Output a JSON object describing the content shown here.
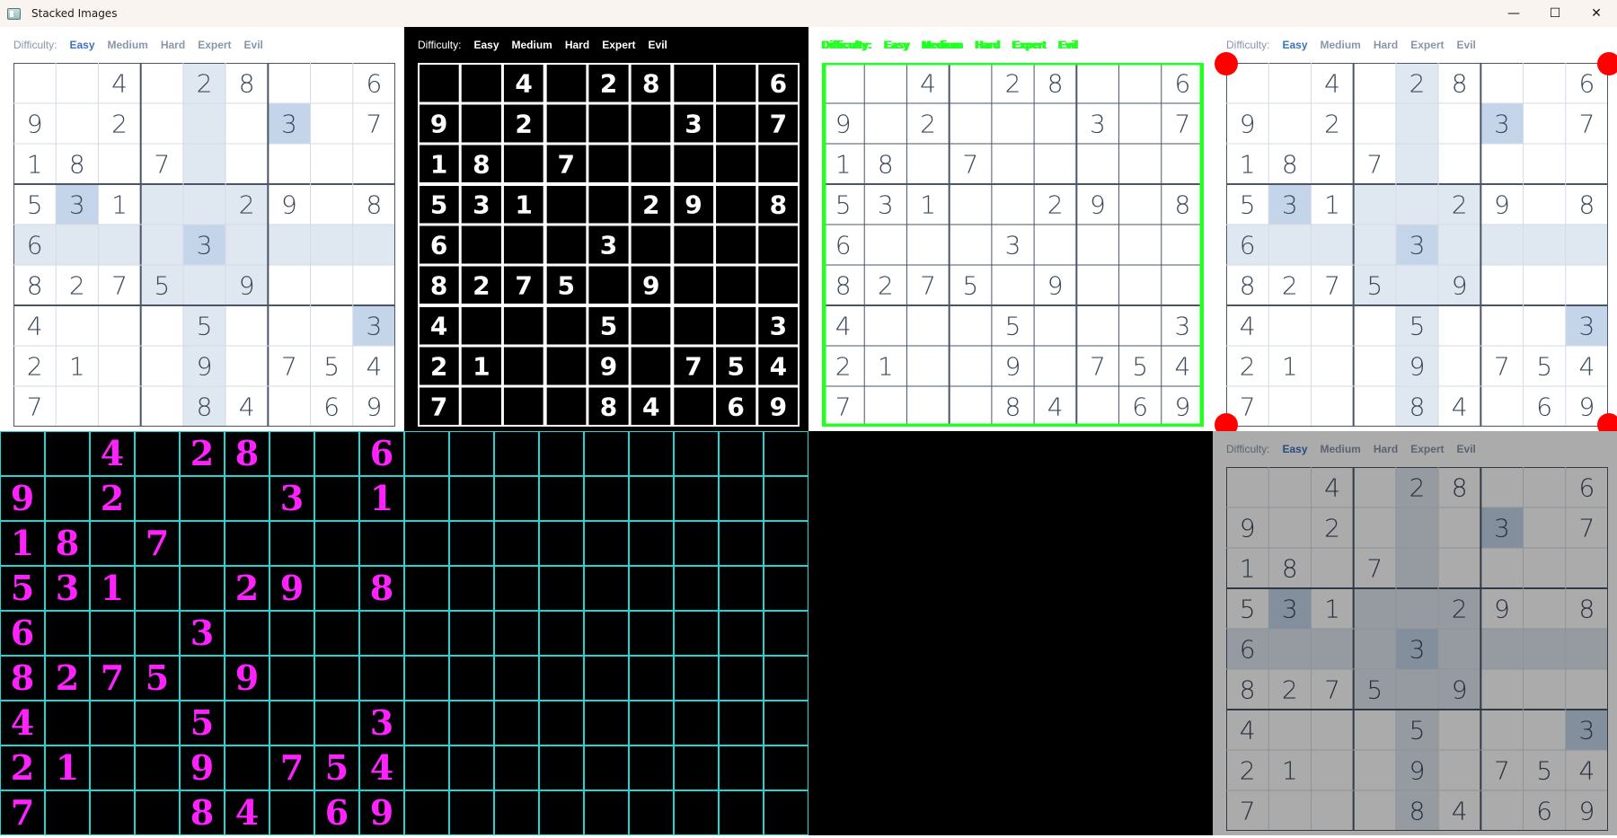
{
  "window": {
    "title": "Stacked Images",
    "minimize_glyph": "—",
    "maximize_glyph": "☐",
    "close_glyph": "✕"
  },
  "difficulty": {
    "label": "Difficulty:",
    "options": [
      "Easy",
      "Medium",
      "Hard",
      "Expert",
      "Evil"
    ],
    "selected": "Easy"
  },
  "puzzle": {
    "grid": [
      "0,0,4,0,2,8,0,0,6",
      "9,0,2,0,0,0,3,0,7",
      "1,8,0,7,0,0,0,0,0",
      "5,3,1,0,0,2,9,0,8",
      "6,0,0,0,3,0,0,0,0",
      "8,2,7,5,0,9,0,0,0",
      "4,0,0,0,5,0,0,0,3",
      "2,1,0,0,9,0,7,5,4",
      "7,0,0,0,8,4,0,6,9"
    ],
    "selected_cell": {
      "row": 4,
      "col": 4
    }
  },
  "recognized_digits": [
    "0,0,4,0,2,8,0,0,6",
    "9,0,2,0,0,0,3,0,1",
    "1,8,0,7,0,0,0,0,0",
    "5,3,1,0,0,2,9,0,8",
    "6,0,0,0,3,0,0,0,0",
    "8,2,7,5,0,9,0,0,0",
    "4,0,0,0,5,0,0,0,3",
    "2,1,0,0,9,0,7,5,4",
    "7,0,0,0,8,4,0,6,9"
  ],
  "colors": {
    "board_line": "#4a5568",
    "digit": "#3c4a5c",
    "highlight": "#dfe7f1",
    "highlight_same": "#c4d5ea",
    "contour": "#22ff22",
    "corner": "#ff0000",
    "warp_grid": "#1fd6d6",
    "warp_digit": "#ff22ff"
  }
}
